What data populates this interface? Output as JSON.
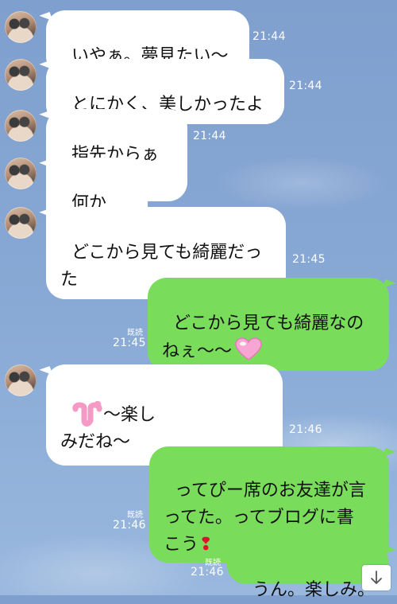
{
  "messages": [
    {
      "side": "left",
      "text": "いやぁ。夢見たい〜",
      "time": "21:44"
    },
    {
      "side": "left",
      "text": "とにかく、美しかったよ",
      "time": "21:44"
    },
    {
      "side": "left",
      "text": "指先からぁぁ",
      "time": "21:44"
    },
    {
      "side": "left",
      "text": "何から〜",
      "time": "21:45"
    },
    {
      "side": "left",
      "text": "どこから見ても綺麗だっ\nた",
      "time": "21:45"
    },
    {
      "side": "right",
      "text": "どこから見ても綺麗なの\nねぇ〜〜",
      "time": "21:45",
      "read": "既読",
      "emoji": "heart-icon"
    },
    {
      "side": "left",
      "text": "〜楽し\nみだね〜",
      "time": "21:46",
      "emoji": "pi-sticker"
    },
    {
      "side": "right",
      "text": "ってぴー席のお友達が言\nってた。ってブログに書\nこう",
      "time": "21:46",
      "read": "既読",
      "emoji": "exclamation-icon"
    },
    {
      "side": "right",
      "text": "うん。楽しみ。",
      "time": "21:46",
      "read": "既読"
    }
  ],
  "colors": {
    "outgoing": "#79dc5a",
    "incoming": "#ffffff",
    "background": "#86a6d3"
  },
  "scroll_button_icon": "arrow-down-icon"
}
